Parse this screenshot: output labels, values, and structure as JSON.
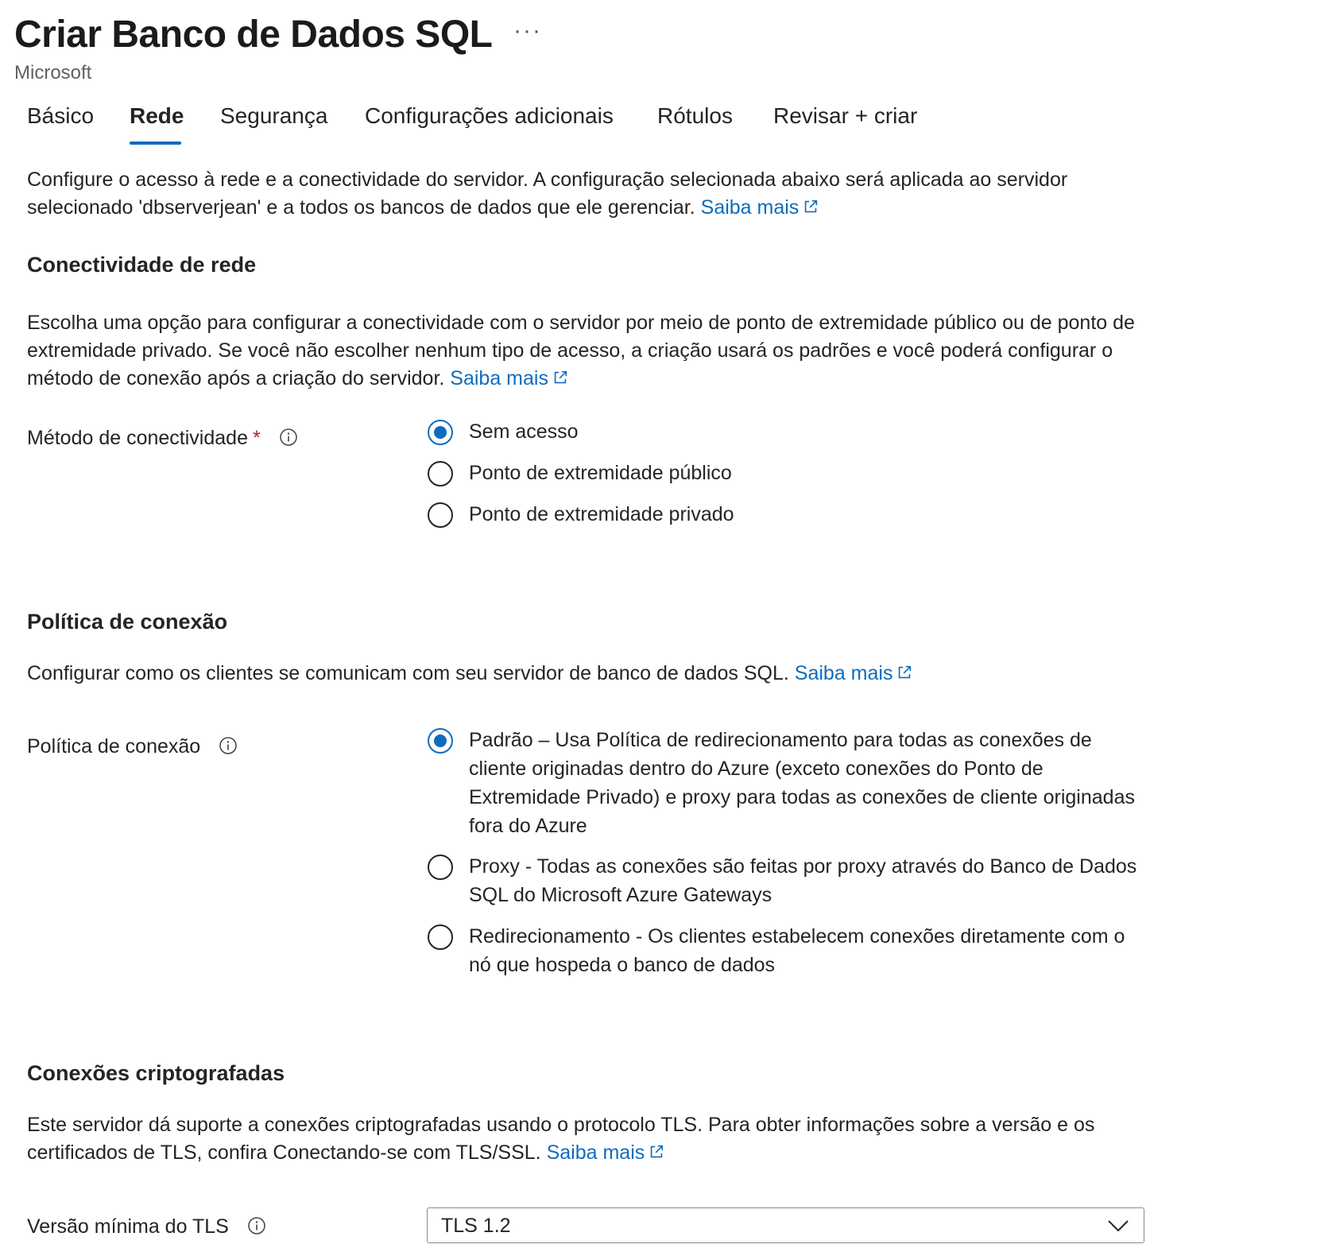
{
  "header": {
    "title": "Criar Banco de Dados SQL",
    "more_label": "···",
    "publisher": "Microsoft"
  },
  "tabs": [
    {
      "label": "Básico",
      "active": false
    },
    {
      "label": "Rede",
      "active": true
    },
    {
      "label": "Segurança",
      "active": false
    },
    {
      "label": "Configurações adicionais",
      "active": false
    },
    {
      "label": "Rótulos",
      "active": false
    },
    {
      "label": "Revisar + criar",
      "active": false
    }
  ],
  "intro": {
    "text": "Configure o acesso à rede e a conectividade do servidor. A configuração selecionada abaixo será aplicada ao servidor selecionado 'dbserverjean' e a todos os bancos de dados que ele gerenciar.",
    "link": "Saiba mais"
  },
  "network_connectivity": {
    "heading": "Conectividade de rede",
    "description": "Escolha uma opção para configurar a conectividade com o servidor por meio de ponto de extremidade público ou de ponto de extremidade privado. Se você não escolher nenhum tipo de acesso, a criação usará os padrões e você poderá configurar o método de conexão após a criação do servidor.",
    "link": "Saiba mais",
    "field_label": "Método de conectividade",
    "required_mark": "*",
    "options": [
      {
        "label": "Sem acesso",
        "selected": true
      },
      {
        "label": "Ponto de extremidade público",
        "selected": false
      },
      {
        "label": "Ponto de extremidade privado",
        "selected": false
      }
    ]
  },
  "connection_policy": {
    "heading": "Política de conexão",
    "description": "Configurar como os clientes se comunicam com seu servidor de banco de dados SQL.",
    "link": "Saiba mais",
    "field_label": "Política de conexão",
    "options": [
      {
        "label": "Padrão – Usa Política de redirecionamento para todas as conexões de cliente originadas dentro do Azure (exceto conexões do Ponto de Extremidade Privado) e proxy para todas as conexões de cliente originadas fora do Azure",
        "selected": true
      },
      {
        "label": "Proxy - Todas as conexões são feitas por proxy através do Banco de Dados SQL do Microsoft Azure Gateways",
        "selected": false
      },
      {
        "label": "Redirecionamento - Os clientes estabelecem conexões diretamente com o nó que hospeda o banco de dados",
        "selected": false
      }
    ]
  },
  "encrypted_connections": {
    "heading": "Conexões criptografadas",
    "description": "Este servidor dá suporte a conexões criptografadas usando o protocolo TLS. Para obter informações sobre a versão e os certificados de TLS, confira Conectando-se com TLS/SSL.",
    "link": "Saiba mais",
    "field_label": "Versão mínima do TLS",
    "selected_value": "TLS 1.2"
  },
  "colors": {
    "accent": "#0f6cbd",
    "required": "#a4262c",
    "text": "#242424"
  }
}
